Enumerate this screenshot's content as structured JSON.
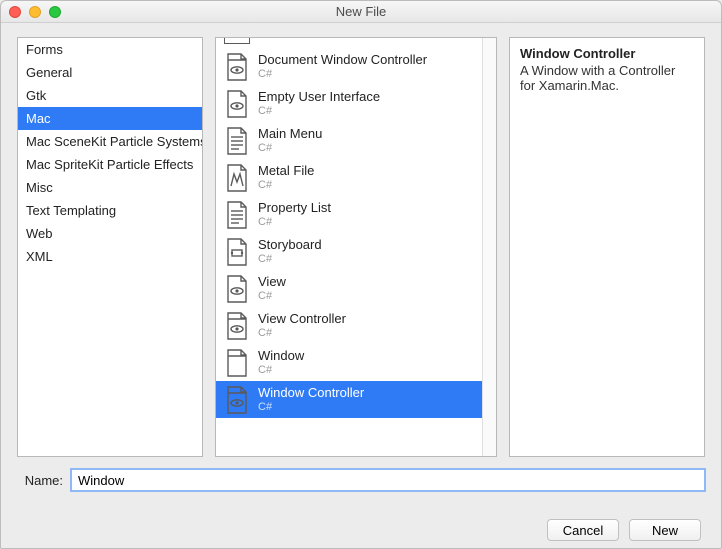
{
  "window": {
    "title": "New File"
  },
  "categories": [
    {
      "label": "Forms",
      "selected": false
    },
    {
      "label": "General",
      "selected": false
    },
    {
      "label": "Gtk",
      "selected": false
    },
    {
      "label": "Mac",
      "selected": true
    },
    {
      "label": "Mac SceneKit Particle Systems",
      "selected": false
    },
    {
      "label": "Mac SpriteKit Particle Effects",
      "selected": false
    },
    {
      "label": "Misc",
      "selected": false
    },
    {
      "label": "Text Templating",
      "selected": false
    },
    {
      "label": "Web",
      "selected": false
    },
    {
      "label": "XML",
      "selected": false
    }
  ],
  "templates": [
    {
      "name": "Document Window Controller",
      "lang": "C#",
      "icon": "window-eye",
      "selected": false
    },
    {
      "name": "Empty User Interface",
      "lang": "C#",
      "icon": "page-eye",
      "selected": false
    },
    {
      "name": "Main Menu",
      "lang": "C#",
      "icon": "page-lines",
      "selected": false
    },
    {
      "name": "Metal File",
      "lang": "C#",
      "icon": "page-metal",
      "selected": false
    },
    {
      "name": "Property List",
      "lang": "C#",
      "icon": "page-lines",
      "selected": false
    },
    {
      "name": "Storyboard",
      "lang": "C#",
      "icon": "page-story",
      "selected": false
    },
    {
      "name": "View",
      "lang": "C#",
      "icon": "page-eye",
      "selected": false
    },
    {
      "name": "View Controller",
      "lang": "C#",
      "icon": "window-eye",
      "selected": false
    },
    {
      "name": "Window",
      "lang": "C#",
      "icon": "page-blank",
      "selected": false
    },
    {
      "name": "Window Controller",
      "lang": "C#",
      "icon": "window-eye",
      "selected": true
    }
  ],
  "detail": {
    "title": "Window Controller",
    "description": "A Window with a Controller for Xamarin.Mac."
  },
  "name_field": {
    "label": "Name:",
    "value": "Window"
  },
  "buttons": {
    "cancel": "Cancel",
    "confirm": "New"
  },
  "colors": {
    "selection": "#2f7bf6"
  }
}
